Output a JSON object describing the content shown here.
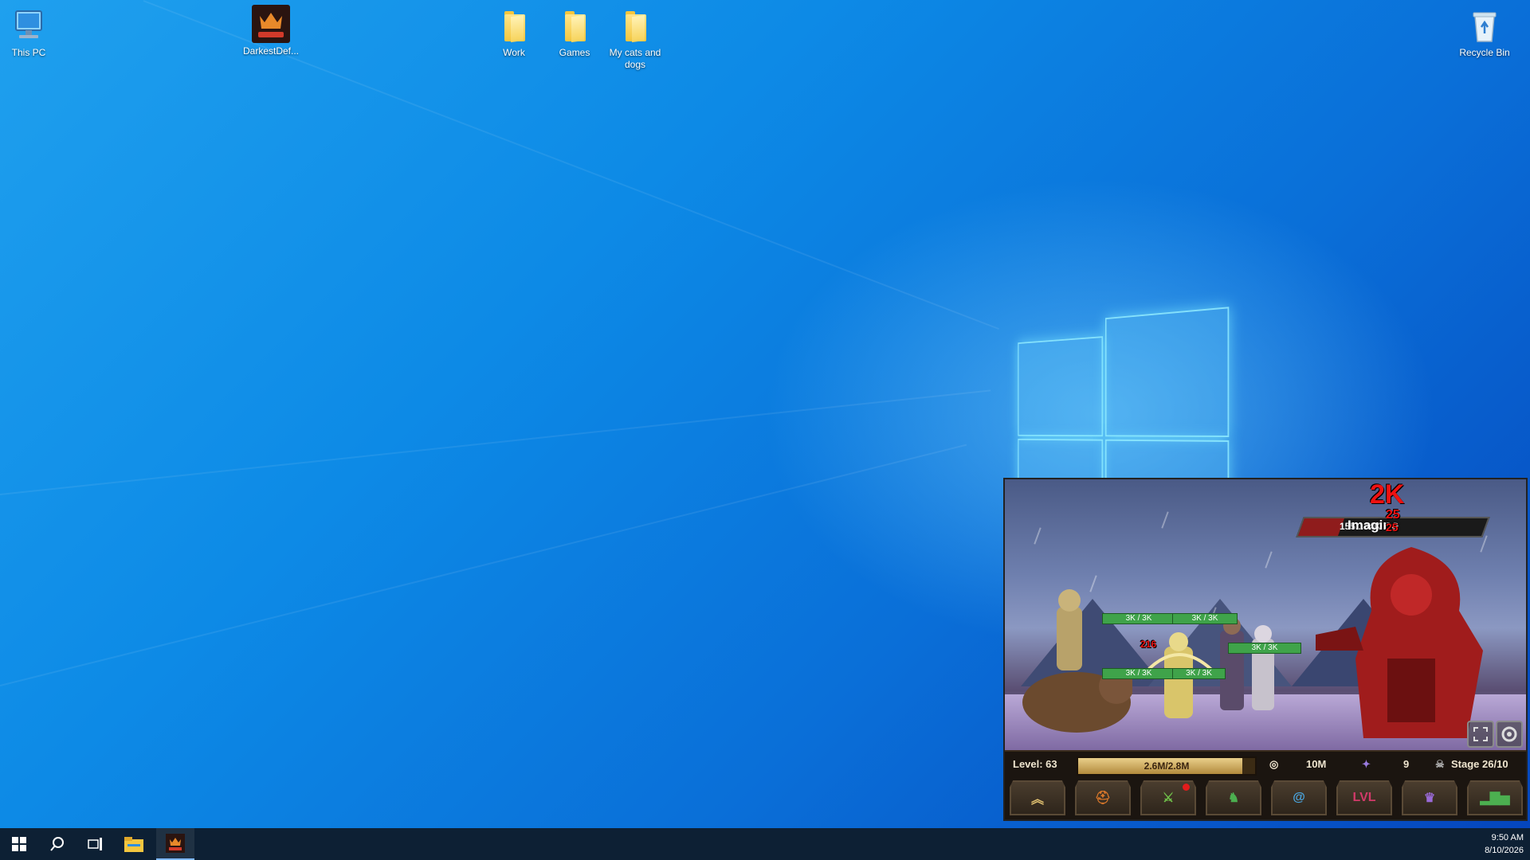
{
  "desktop": {
    "icons": [
      {
        "label": "This PC"
      },
      {
        "label": "DarkestDef..."
      },
      {
        "label": "Work"
      },
      {
        "label": "Games"
      },
      {
        "label": "My cats and dogs"
      },
      {
        "label": "Recycle Bin"
      }
    ]
  },
  "taskbar": {
    "clock_time": "9:50 AM",
    "clock_date": "8/10/2026"
  },
  "game": {
    "boss_name": "Imagine",
    "boss_hp_text": "155...34K",
    "damage_big": "2K",
    "damage_small": "25",
    "damage_small2": "25",
    "unit_damage": "216",
    "unit_hp": [
      "3K / 3K",
      "3K / 3K",
      "3K / 3K",
      "3K / 3K",
      "3K / 3K"
    ],
    "level_label": "Level: 63",
    "xp_text": "2.6M/2.8M",
    "xp_fraction": 0.93,
    "gold": "10M",
    "gems": "9",
    "stage": "Stage 26/10",
    "tools": [
      {
        "icon": "upgrade-chevrons-icon",
        "label": ""
      },
      {
        "icon": "helmet-icon",
        "label": ""
      },
      {
        "icon": "sword-icon",
        "label": ""
      },
      {
        "icon": "horse-icon",
        "label": ""
      },
      {
        "icon": "portal-icon",
        "label": ""
      },
      {
        "icon": "lvl-icon",
        "label": "LVL"
      },
      {
        "icon": "crown-icon",
        "label": ""
      },
      {
        "icon": "stats-icon",
        "label": ""
      }
    ],
    "colors": {
      "boss": "#a01c1c",
      "hp_bar": "#3fa34a",
      "xp": "#d8b868"
    }
  }
}
